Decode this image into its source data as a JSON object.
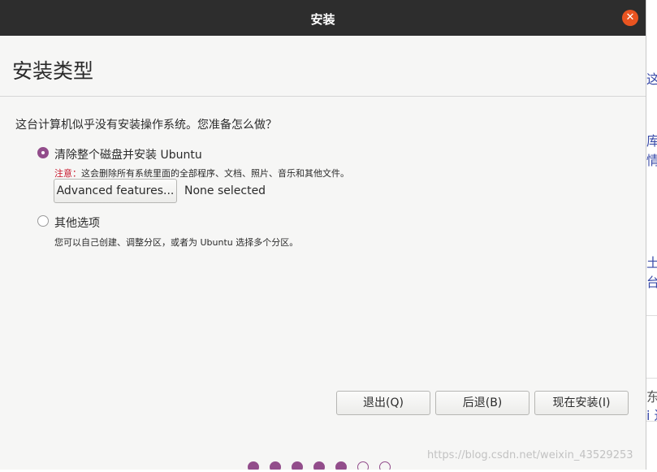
{
  "window": {
    "title": "安装",
    "close_glyph": "✕"
  },
  "page": {
    "heading": "安装类型",
    "question": "这台计算机似乎没有安装操作系统。您准备怎么做？"
  },
  "options": [
    {
      "label": "清除整个磁盘并安装 Ubuntu",
      "checked": true,
      "warning_key": "注意：",
      "warning_text": "这会删除所有系统里面的全部程序、文档、照片、音乐和其他文件。",
      "advanced_button": "Advanced features...",
      "advanced_status": "None selected"
    },
    {
      "label": "其他选项",
      "checked": false,
      "description": "您可以自己创建、调整分区，或者为 Ubuntu 选择多个分区。"
    }
  ],
  "buttons": {
    "quit": "退出(Q)",
    "back": "后退(B)",
    "install": "现在安装(I)"
  },
  "progress": {
    "total_steps": 7,
    "completed_steps": 5
  },
  "background_fragments": [
    "这",
    "库(",
    "情",
    "土结",
    "台",
    "东",
    "i 过"
  ],
  "watermark": "https://blog.csdn.net/weixin_43529253",
  "colors": {
    "titlebar": "#2d2d2d",
    "close_button": "#e95420",
    "accent": "#924d8b",
    "warning": "#c7162b"
  }
}
